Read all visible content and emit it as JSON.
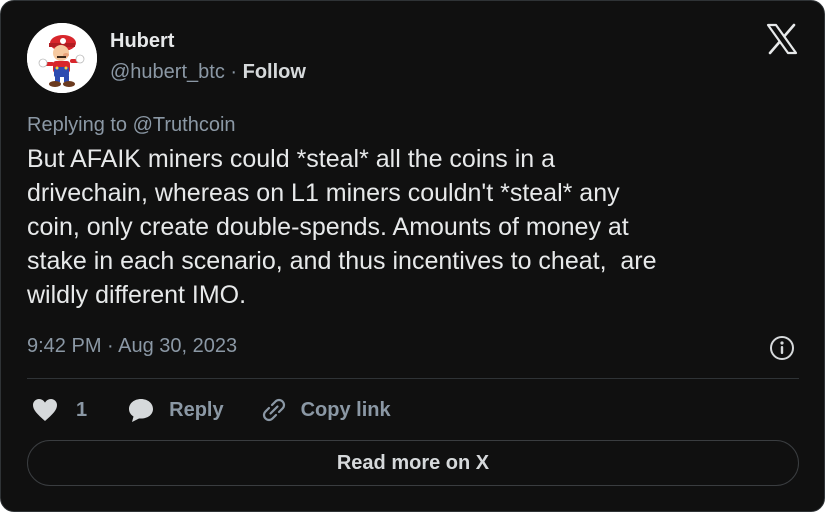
{
  "author": {
    "name": "Hubert",
    "handle": "@hubert_btc",
    "separator": "·",
    "follow_label": "Follow"
  },
  "tweet": {
    "replying_to": "Replying to @Truthcoin",
    "text": "But AFAIK miners could *steal* all the coins in a\ndrivechain, whereas on L1 miners couldn't *steal* any\ncoin, only create double-spends. Amounts of money at\nstake in each scenario, and thus incentives to cheat,  are\nwildly different IMO.",
    "timestamp": "9:42 PM · Aug 30, 2023"
  },
  "actions": {
    "like_count": "1",
    "reply_label": "Reply",
    "copy_label": "Copy link"
  },
  "read_more_label": "Read more on X",
  "icons": {
    "avatar": "mario-avatar",
    "logo": "x-logo-icon",
    "info": "info-icon",
    "like": "heart-icon",
    "reply": "speech-bubble-icon",
    "copy": "link-icon"
  },
  "colors": {
    "background": "#101010",
    "text": "#e7e9ea",
    "secondary": "#8b98a5",
    "border": "#2f3336"
  }
}
